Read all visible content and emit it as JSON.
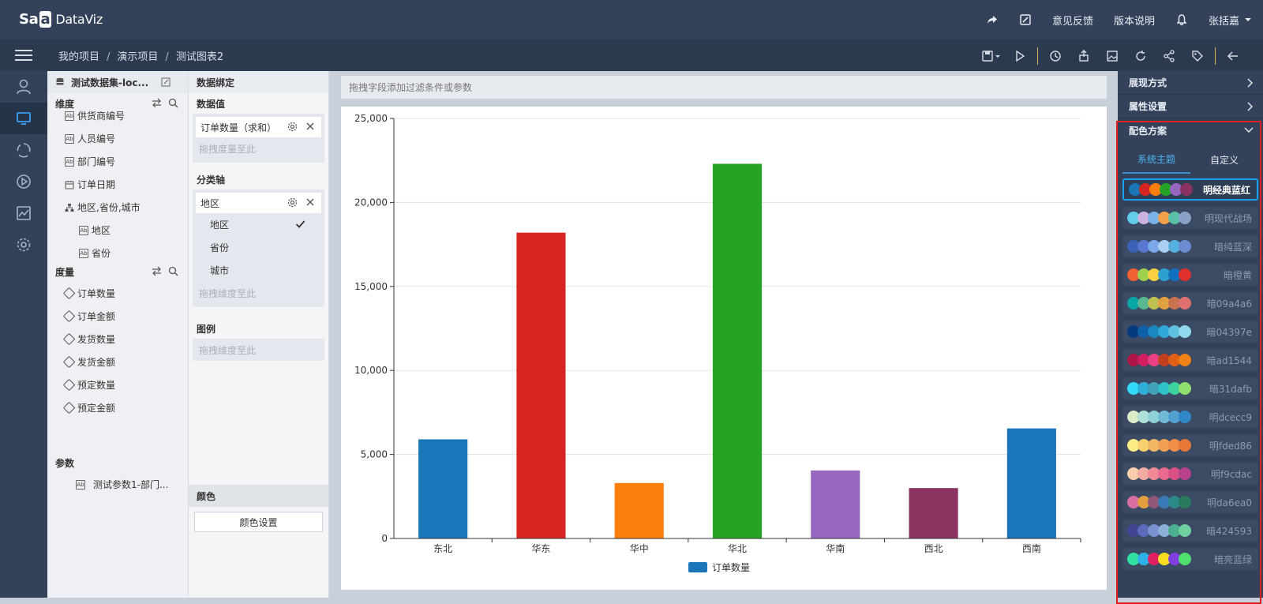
{
  "app": {
    "logo_main": "Sa",
    "logo_mid": "a",
    "logo_sub": "DataViz"
  },
  "topbar": {
    "feedback": "意见反馈",
    "version": "版本说明",
    "user": "张括嘉"
  },
  "breadcrumb": [
    "我的项目",
    "演示项目",
    "测试图表2"
  ],
  "fields": {
    "dataset": "测试数据集-loc...",
    "dim_title": "维度",
    "dimensions": [
      {
        "label": "供货商编号",
        "type": "ab",
        "level": 1
      },
      {
        "label": "人员编号",
        "type": "ab",
        "level": 1
      },
      {
        "label": "部门编号",
        "type": "ab",
        "level": 1
      },
      {
        "label": "订单日期",
        "type": "date",
        "level": 1
      },
      {
        "label": "地区,省份,城市",
        "type": "hier",
        "level": 1
      },
      {
        "label": "地区",
        "type": "ab",
        "level": 2
      },
      {
        "label": "省份",
        "type": "ab",
        "level": 2
      },
      {
        "label": "城市",
        "type": "ab",
        "level": 2
      }
    ],
    "measure_title": "度量",
    "measures": [
      "订单数量",
      "订单金额",
      "发货数量",
      "发货金额",
      "预定数量",
      "预定金额"
    ],
    "param_title": "参数",
    "params": [
      "测试参数1-部门..."
    ]
  },
  "binding": {
    "title": "数据绑定",
    "value_label": "数据值",
    "value_pill": "订单数量（求和）",
    "value_placeholder": "拖拽度量至此",
    "axis_label": "分类轴",
    "axis_pill": "地区",
    "axis_options": [
      "地区",
      "省份",
      "城市"
    ],
    "axis_placeholder": "拖拽维度至此",
    "legend_label": "图例",
    "legend_placeholder": "拖拽维度至此",
    "color_label": "颜色",
    "color_button": "颜色设置"
  },
  "filter_placeholder": "拖拽字段添加过滤条件或参数",
  "chart_data": {
    "type": "bar",
    "categories": [
      "东北",
      "华东",
      "华中",
      "华北",
      "华南",
      "西北",
      "西南"
    ],
    "values": [
      5900,
      18200,
      3300,
      22300,
      4050,
      3000,
      6550
    ],
    "colors": [
      "#1a76b8",
      "#d62521",
      "#fd7f0b",
      "#27a224",
      "#9766be",
      "#8b3360",
      "#1a76b8"
    ],
    "ylim": [
      0,
      25000
    ],
    "yticks": [
      "0",
      "5,000",
      "10,000",
      "15,000",
      "20,000",
      "25,000"
    ],
    "series": [
      {
        "name": "订单数量",
        "color": "#1a76b8"
      }
    ]
  },
  "right": {
    "display": "展现方式",
    "props": "属性设置",
    "color_scheme": "配色方案",
    "tab_system": "系统主题",
    "tab_custom": "自定义",
    "schemes": [
      {
        "name": "明经典蓝红",
        "colors": [
          "#1a76b8",
          "#d62521",
          "#fd7f0b",
          "#27a224",
          "#9766be",
          "#8b3360"
        ],
        "selected": true
      },
      {
        "name": "明现代战场",
        "colors": [
          "#66ccee",
          "#cdb3e0",
          "#7ab3e8",
          "#f2a04a",
          "#5cc0a8",
          "#8ba0c8"
        ]
      },
      {
        "name": "暗纯蓝深",
        "colors": [
          "#3a62b8",
          "#5a78d0",
          "#7aa8e8",
          "#a8d0f0",
          "#58b0e0",
          "#6a8cd0"
        ]
      },
      {
        "name": "暗橙黄",
        "colors": [
          "#f06030",
          "#a0d050",
          "#f8d040",
          "#2ea0d0",
          "#1070c0",
          "#e03030"
        ]
      },
      {
        "name": "暗09a4a6",
        "colors": [
          "#09a4a6",
          "#5ab890",
          "#c0c050",
          "#e0a040",
          "#c87050",
          "#e07070"
        ]
      },
      {
        "name": "暗04397e",
        "colors": [
          "#04397e",
          "#1060a8",
          "#1a88c0",
          "#30a8d8",
          "#60c0e0",
          "#90d8f0"
        ]
      },
      {
        "name": "暗ad1544",
        "colors": [
          "#ad1544",
          "#d02060",
          "#e84080",
          "#c04020",
          "#e06018",
          "#f08018"
        ]
      },
      {
        "name": "暗31dafb",
        "colors": [
          "#31dafb",
          "#30b0d8",
          "#40a0b8",
          "#30c0c8",
          "#40d0a0",
          "#90e070"
        ]
      },
      {
        "name": "明dcecc9",
        "colors": [
          "#dcecc9",
          "#b0e0d8",
          "#90d0d8",
          "#70b8d8",
          "#50a0d0",
          "#3088c8"
        ]
      },
      {
        "name": "明fded86",
        "colors": [
          "#fded86",
          "#f8d070",
          "#f0b860",
          "#f0a050",
          "#f09048",
          "#e87838"
        ]
      },
      {
        "name": "明f9cdac",
        "colors": [
          "#f9cdac",
          "#f3aca2",
          "#ee8b97",
          "#e96a8d",
          "#db5087",
          "#b8428c"
        ]
      },
      {
        "name": "明da6ea0",
        "colors": [
          "#da6ea0",
          "#e0a040",
          "#905878",
          "#3a7ab8",
          "#2a8a88",
          "#2a7a60"
        ]
      },
      {
        "name": "暗424593",
        "colors": [
          "#424593",
          "#5a6ab8",
          "#7a90d0",
          "#8ab0d8",
          "#4ab090",
          "#70d0a0"
        ]
      },
      {
        "name": "暗亮蓝绿",
        "colors": [
          "#30e0a0",
          "#30b0e8",
          "#e02060",
          "#f8e020",
          "#8040e0",
          "#50e070"
        ]
      }
    ]
  }
}
